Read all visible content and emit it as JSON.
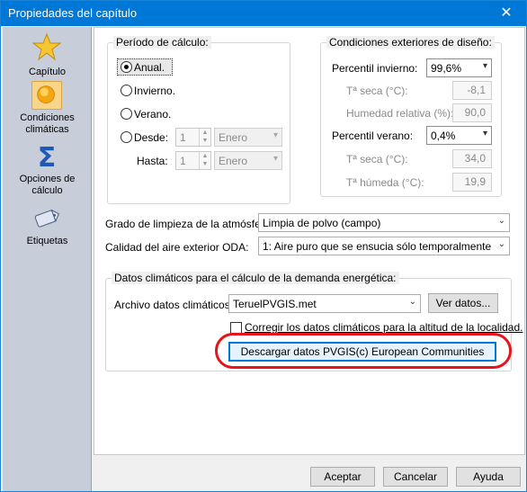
{
  "window": {
    "title": "Propiedades del capítulo",
    "close_glyph": "✕"
  },
  "sidebar": {
    "items": [
      {
        "label": "Capítulo",
        "icon": "star-icon"
      },
      {
        "label": "Condiciones climáticas",
        "icon": "sun-icon",
        "active": true
      },
      {
        "label": "Opciones de cálculo",
        "icon": "sigma-icon"
      },
      {
        "label": "Etiquetas",
        "icon": "tag-icon"
      }
    ]
  },
  "period": {
    "legend": "Período de cálculo:",
    "options": [
      "Anual.",
      "Invierno.",
      "Verano.",
      "Desde:"
    ],
    "selected": "Anual.",
    "from": {
      "day": "1",
      "month": "Enero"
    },
    "to_label": "Hasta:",
    "to": {
      "day": "1",
      "month": "Enero"
    }
  },
  "design": {
    "legend": "Condiciones exteriores de diseño:",
    "winter_label": "Percentil invierno:",
    "winter_value": "99,6%",
    "dry_temp_label": "Tª seca (°C):",
    "winter_dry": "-8,1",
    "humidity_label": "Humedad relativa (%):",
    "winter_humidity": "90,0",
    "summer_label": "Percentil verano:",
    "summer_value": "0,4%",
    "summer_dry": "34,0",
    "wet_temp_label": "Tª húmeda (°C):",
    "summer_wet": "19,9"
  },
  "atmosphere": {
    "cleanliness_label": "Grado de limpieza de la atmósfera:",
    "cleanliness_value": "Limpia de polvo (campo)",
    "oda_label": "Calidad del aire exterior ODA:",
    "oda_value": "1: Aire puro que se ensucia sólo temporalmente"
  },
  "climate": {
    "legend": "Datos climáticos para el cálculo de la demanda energética:",
    "file_label": "Archivo datos climáticos:",
    "file_value": "TeruelPVGIS.met",
    "view_button": "Ver datos...",
    "correct_label": "Corregir los datos climáticos para la altitud de la localidad.",
    "download_button": "Descargar datos PVGIS(c) European Communities"
  },
  "footer": {
    "accept": "Aceptar",
    "cancel": "Cancelar",
    "help": "Ayuda"
  },
  "colors": {
    "titlebar": "#0078d7",
    "highlight_ring": "#e8141c"
  }
}
